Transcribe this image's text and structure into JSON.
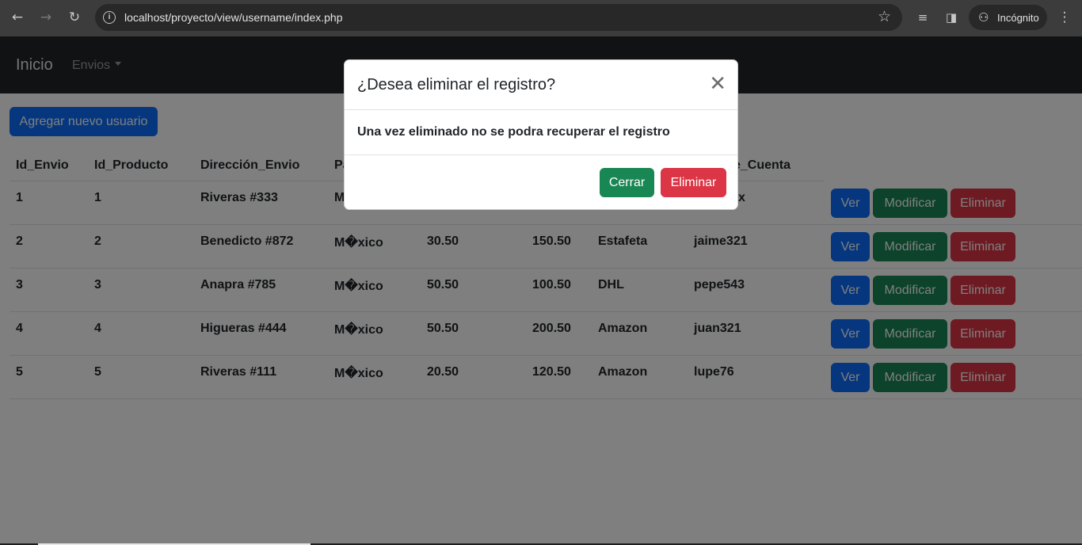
{
  "browser": {
    "url": "localhost/proyecto/view/username/index.php",
    "incognito_label": "Incógnito"
  },
  "navbar": {
    "brand": "Inicio",
    "dropdown": "Envios"
  },
  "page": {
    "add_button": "Agregar nuevo usuario"
  },
  "table": {
    "headers": [
      "Id_Envio",
      "Id_Producto",
      "Dirección_Envio",
      "Pa",
      "",
      "",
      "",
      "e_Cuenta"
    ],
    "rows": [
      {
        "id_envio": "1",
        "id_producto": "1",
        "direccion": "Riveras #333",
        "pais": "M",
        "costo": "",
        "total": "",
        "paqueteria": "",
        "cuenta": "x"
      },
      {
        "id_envio": "2",
        "id_producto": "2",
        "direccion": "Benedicto #872",
        "pais": "M�xico",
        "costo": "30.50",
        "total": "150.50",
        "paqueteria": "Estafeta",
        "cuenta": "jaime321"
      },
      {
        "id_envio": "3",
        "id_producto": "3",
        "direccion": "Anapra #785",
        "pais": "M�xico",
        "costo": "50.50",
        "total": "100.50",
        "paqueteria": "DHL",
        "cuenta": "pepe543"
      },
      {
        "id_envio": "4",
        "id_producto": "4",
        "direccion": "Higueras #444",
        "pais": "M�xico",
        "costo": "50.50",
        "total": "200.50",
        "paqueteria": "Amazon",
        "cuenta": "juan321"
      },
      {
        "id_envio": "5",
        "id_producto": "5",
        "direccion": "Riveras #111",
        "pais": "M�xico",
        "costo": "20.50",
        "total": "120.50",
        "paqueteria": "Amazon",
        "cuenta": "lupe76"
      }
    ],
    "actions": {
      "view": "Ver",
      "edit": "Modificar",
      "delete": "Eliminar"
    }
  },
  "modal": {
    "title": "¿Desea eliminar el registro?",
    "body": "Una vez eliminado no se podra recuperar el registro",
    "close_button": "Cerrar",
    "delete_button": "Eliminar"
  },
  "colors": {
    "primary": "#0d6efd",
    "success": "#198754",
    "danger": "#dc3545",
    "navbar": "#212529"
  }
}
